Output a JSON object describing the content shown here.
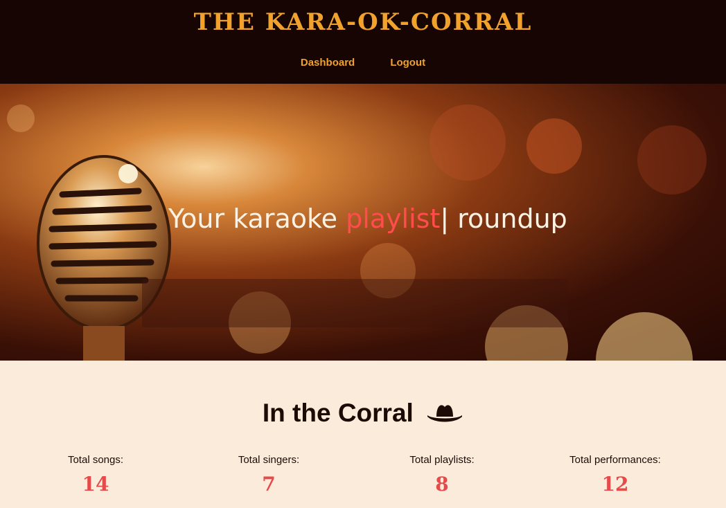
{
  "header": {
    "brand": "THE KARA-OK-CORRAL",
    "nav": [
      {
        "label": "Dashboard"
      },
      {
        "label": "Logout"
      }
    ]
  },
  "hero": {
    "text_before": "Your karaoke ",
    "text_highlight": "playlist",
    "text_after": "| roundup",
    "highlight_color": "#ff4c4c"
  },
  "section": {
    "title": "In the Corral",
    "icon": "cowboy-hat-icon"
  },
  "stats": [
    {
      "label": "Total songs:",
      "value": "14"
    },
    {
      "label": "Total singers:",
      "value": "7"
    },
    {
      "label": "Total playlists:",
      "value": "8"
    },
    {
      "label": "Total performances:",
      "value": "12"
    }
  ],
  "colors": {
    "header_bg": "#160502",
    "brand": "#f0a22d",
    "page_bg": "#fbebdb",
    "stat_value": "#e64a4a"
  }
}
